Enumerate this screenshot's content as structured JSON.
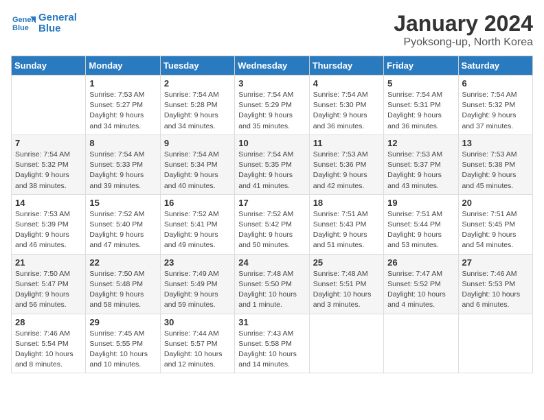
{
  "header": {
    "logo_line1": "General",
    "logo_line2": "Blue",
    "month_title": "January 2024",
    "subtitle": "Pyoksong-up, North Korea"
  },
  "days_of_week": [
    "Sunday",
    "Monday",
    "Tuesday",
    "Wednesday",
    "Thursday",
    "Friday",
    "Saturday"
  ],
  "weeks": [
    [
      {
        "day": "",
        "info": ""
      },
      {
        "day": "1",
        "info": "Sunrise: 7:53 AM\nSunset: 5:27 PM\nDaylight: 9 hours\nand 34 minutes."
      },
      {
        "day": "2",
        "info": "Sunrise: 7:54 AM\nSunset: 5:28 PM\nDaylight: 9 hours\nand 34 minutes."
      },
      {
        "day": "3",
        "info": "Sunrise: 7:54 AM\nSunset: 5:29 PM\nDaylight: 9 hours\nand 35 minutes."
      },
      {
        "day": "4",
        "info": "Sunrise: 7:54 AM\nSunset: 5:30 PM\nDaylight: 9 hours\nand 36 minutes."
      },
      {
        "day": "5",
        "info": "Sunrise: 7:54 AM\nSunset: 5:31 PM\nDaylight: 9 hours\nand 36 minutes."
      },
      {
        "day": "6",
        "info": "Sunrise: 7:54 AM\nSunset: 5:32 PM\nDaylight: 9 hours\nand 37 minutes."
      }
    ],
    [
      {
        "day": "7",
        "info": "Sunrise: 7:54 AM\nSunset: 5:32 PM\nDaylight: 9 hours\nand 38 minutes."
      },
      {
        "day": "8",
        "info": "Sunrise: 7:54 AM\nSunset: 5:33 PM\nDaylight: 9 hours\nand 39 minutes."
      },
      {
        "day": "9",
        "info": "Sunrise: 7:54 AM\nSunset: 5:34 PM\nDaylight: 9 hours\nand 40 minutes."
      },
      {
        "day": "10",
        "info": "Sunrise: 7:54 AM\nSunset: 5:35 PM\nDaylight: 9 hours\nand 41 minutes."
      },
      {
        "day": "11",
        "info": "Sunrise: 7:53 AM\nSunset: 5:36 PM\nDaylight: 9 hours\nand 42 minutes."
      },
      {
        "day": "12",
        "info": "Sunrise: 7:53 AM\nSunset: 5:37 PM\nDaylight: 9 hours\nand 43 minutes."
      },
      {
        "day": "13",
        "info": "Sunrise: 7:53 AM\nSunset: 5:38 PM\nDaylight: 9 hours\nand 45 minutes."
      }
    ],
    [
      {
        "day": "14",
        "info": "Sunrise: 7:53 AM\nSunset: 5:39 PM\nDaylight: 9 hours\nand 46 minutes."
      },
      {
        "day": "15",
        "info": "Sunrise: 7:52 AM\nSunset: 5:40 PM\nDaylight: 9 hours\nand 47 minutes."
      },
      {
        "day": "16",
        "info": "Sunrise: 7:52 AM\nSunset: 5:41 PM\nDaylight: 9 hours\nand 49 minutes."
      },
      {
        "day": "17",
        "info": "Sunrise: 7:52 AM\nSunset: 5:42 PM\nDaylight: 9 hours\nand 50 minutes."
      },
      {
        "day": "18",
        "info": "Sunrise: 7:51 AM\nSunset: 5:43 PM\nDaylight: 9 hours\nand 51 minutes."
      },
      {
        "day": "19",
        "info": "Sunrise: 7:51 AM\nSunset: 5:44 PM\nDaylight: 9 hours\nand 53 minutes."
      },
      {
        "day": "20",
        "info": "Sunrise: 7:51 AM\nSunset: 5:45 PM\nDaylight: 9 hours\nand 54 minutes."
      }
    ],
    [
      {
        "day": "21",
        "info": "Sunrise: 7:50 AM\nSunset: 5:47 PM\nDaylight: 9 hours\nand 56 minutes."
      },
      {
        "day": "22",
        "info": "Sunrise: 7:50 AM\nSunset: 5:48 PM\nDaylight: 9 hours\nand 58 minutes."
      },
      {
        "day": "23",
        "info": "Sunrise: 7:49 AM\nSunset: 5:49 PM\nDaylight: 9 hours\nand 59 minutes."
      },
      {
        "day": "24",
        "info": "Sunrise: 7:48 AM\nSunset: 5:50 PM\nDaylight: 10 hours\nand 1 minute."
      },
      {
        "day": "25",
        "info": "Sunrise: 7:48 AM\nSunset: 5:51 PM\nDaylight: 10 hours\nand 3 minutes."
      },
      {
        "day": "26",
        "info": "Sunrise: 7:47 AM\nSunset: 5:52 PM\nDaylight: 10 hours\nand 4 minutes."
      },
      {
        "day": "27",
        "info": "Sunrise: 7:46 AM\nSunset: 5:53 PM\nDaylight: 10 hours\nand 6 minutes."
      }
    ],
    [
      {
        "day": "28",
        "info": "Sunrise: 7:46 AM\nSunset: 5:54 PM\nDaylight: 10 hours\nand 8 minutes."
      },
      {
        "day": "29",
        "info": "Sunrise: 7:45 AM\nSunset: 5:55 PM\nDaylight: 10 hours\nand 10 minutes."
      },
      {
        "day": "30",
        "info": "Sunrise: 7:44 AM\nSunset: 5:57 PM\nDaylight: 10 hours\nand 12 minutes."
      },
      {
        "day": "31",
        "info": "Sunrise: 7:43 AM\nSunset: 5:58 PM\nDaylight: 10 hours\nand 14 minutes."
      },
      {
        "day": "",
        "info": ""
      },
      {
        "day": "",
        "info": ""
      },
      {
        "day": "",
        "info": ""
      }
    ]
  ]
}
